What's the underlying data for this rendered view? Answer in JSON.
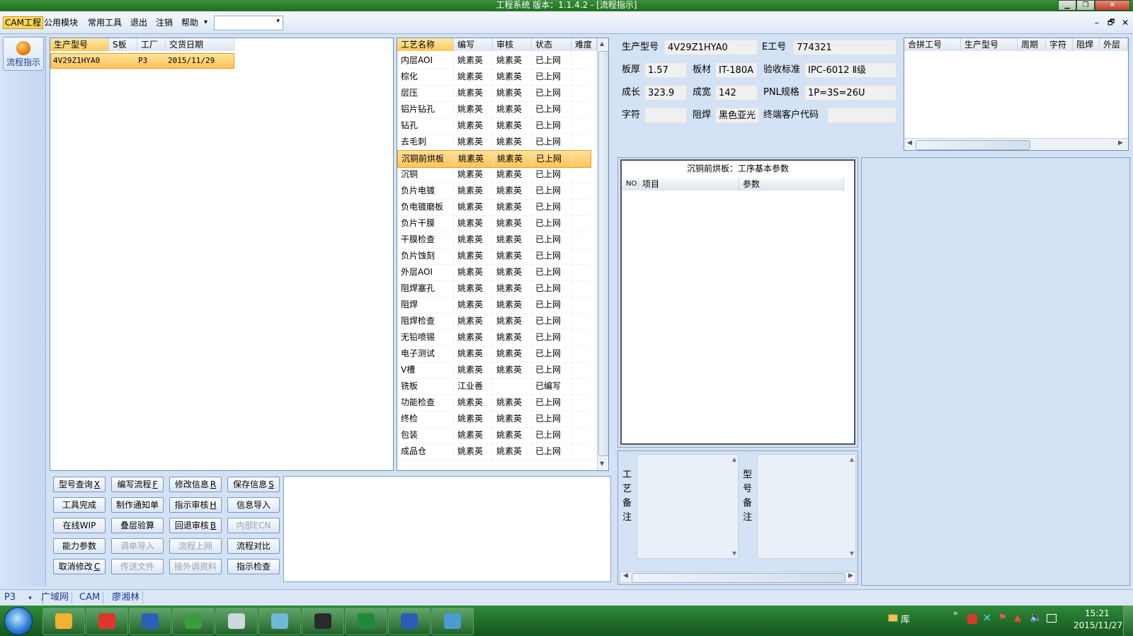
{
  "window": {
    "title": "工程系统   版本：1.1.4.2 - [流程指示]",
    "min_icon": "minimize-icon",
    "max_icon": "maximize-icon",
    "close_icon": "close-icon",
    "min_glyph": "▁",
    "max_glyph": "❐",
    "close_glyph": "✕"
  },
  "menubar": {
    "items": [
      "CAM工程",
      "公用模块",
      "常用工具",
      "退出",
      "注销",
      "帮助"
    ],
    "help_arrow": "▾",
    "combo_value": "",
    "combo_arrow": "▾",
    "mdi_min": "–",
    "mdi_restore": "🗗",
    "mdi_close": "✕"
  },
  "nav": {
    "button_label": "流程指示"
  },
  "order_table": {
    "columns": [
      "生产型号",
      "S板",
      "工厂",
      "交货日期"
    ],
    "rows": [
      {
        "model": "4V29Z1HYA0",
        "s": "",
        "factory": "P3",
        "date": "2015/11/29"
      }
    ]
  },
  "process_table": {
    "columns": [
      "工艺名称",
      "编写",
      "审核",
      "状态",
      "难度"
    ],
    "selected_index": 6,
    "rows": [
      [
        "内层AOI",
        "姚素英",
        "姚素英",
        "已上网"
      ],
      [
        "棕化",
        "姚素英",
        "姚素英",
        "已上网"
      ],
      [
        "层压",
        "姚素英",
        "姚素英",
        "已上网"
      ],
      [
        "铝片钻孔",
        "姚素英",
        "姚素英",
        "已上网"
      ],
      [
        "钻孔",
        "姚素英",
        "姚素英",
        "已上网"
      ],
      [
        "去毛刺",
        "姚素英",
        "姚素英",
        "已上网"
      ],
      [
        "沉铜前烘板",
        "姚素英",
        "姚素英",
        "已上网"
      ],
      [
        "沉铜",
        "姚素英",
        "姚素英",
        "已上网"
      ],
      [
        "负片电镀",
        "姚素英",
        "姚素英",
        "已上网"
      ],
      [
        "负电镀磨板",
        "姚素英",
        "姚素英",
        "已上网"
      ],
      [
        "负片干膜",
        "姚素英",
        "姚素英",
        "已上网"
      ],
      [
        "干膜检查",
        "姚素英",
        "姚素英",
        "已上网"
      ],
      [
        "负片蚀刻",
        "姚素英",
        "姚素英",
        "已上网"
      ],
      [
        "外层AOI",
        "姚素英",
        "姚素英",
        "已上网"
      ],
      [
        "阻焊塞孔",
        "姚素英",
        "姚素英",
        "已上网"
      ],
      [
        "阻焊",
        "姚素英",
        "姚素英",
        "已上网"
      ],
      [
        "阻焊检查",
        "姚素英",
        "姚素英",
        "已上网"
      ],
      [
        "无铅喷锡",
        "姚素英",
        "姚素英",
        "已上网"
      ],
      [
        "电子测试",
        "姚素英",
        "姚素英",
        "已上网"
      ],
      [
        "V槽",
        "姚素英",
        "姚素英",
        "已上网"
      ],
      [
        "铣板",
        "江业善",
        "",
        "已编写"
      ],
      [
        "功能检查",
        "姚素英",
        "姚素英",
        "已上网"
      ],
      [
        "终检",
        "姚素英",
        "姚素英",
        "已上网"
      ],
      [
        "包装",
        "姚素英",
        "姚素英",
        "已上网"
      ],
      [
        "成品仓",
        "姚素英",
        "姚素英",
        "已上网"
      ]
    ]
  },
  "info": {
    "model_label": "生产型号",
    "model_value": "4V29Z1HYA0",
    "e_label": "E工号",
    "e_value": "774321",
    "thickness_label": "板厚",
    "thickness_value": "1.57",
    "material_label": "板材",
    "material_value": "IT-180A",
    "standard_label": "验收标准",
    "standard_value": "IPC-6012 Ⅱ级",
    "len_label": "成长",
    "len_value": "323.9",
    "wid_label": "成宽",
    "wid_value": "142",
    "pnl_label": "PNL规格",
    "pnl_value": "1P=3S=26U",
    "char_label": "字符",
    "char_value": "",
    "mask_label": "阻焊",
    "mask_value": "黑色亚光",
    "cust_label": "终端客户代码",
    "cust_value": ""
  },
  "merge_table": {
    "columns": [
      "合拼工号",
      "生产型号",
      "周期",
      "字符",
      "阻焊",
      "外层"
    ]
  },
  "params": {
    "title": "沉铜前烘板：工序基本参数",
    "columns": [
      "NO",
      "项目",
      "参数"
    ]
  },
  "notes": {
    "process_label": "工\n艺\n备\n注",
    "model_label": "型\n号\n备\n注"
  },
  "buttons": [
    [
      "型号查询",
      "X"
    ],
    [
      "编写流程",
      "F"
    ],
    [
      "修改信息",
      "R"
    ],
    [
      "保存信息",
      "S"
    ],
    [
      "工具完成",
      ""
    ],
    [
      "制作通知单",
      ""
    ],
    [
      "指示审核",
      "H"
    ],
    [
      "信息导入",
      ""
    ],
    [
      "在线WIP",
      ""
    ],
    [
      "叠层验算",
      ""
    ],
    [
      "回退审核",
      "B"
    ],
    [
      "内部ECN",
      ""
    ],
    [
      "能力参数",
      ""
    ],
    [
      "调单导入",
      ""
    ],
    [
      "流程上网",
      ""
    ],
    [
      "流程对比",
      ""
    ],
    [
      "取消修改",
      "C"
    ],
    [
      "传送文件",
      ""
    ],
    [
      "接外调资料",
      ""
    ],
    [
      "指示检查",
      ""
    ]
  ],
  "disabled_buttons": [
    11,
    13,
    14,
    17,
    18
  ],
  "statusbar": {
    "factory": "P3",
    "network": "广域网",
    "dept": "CAM",
    "user": "廖湘林"
  },
  "taskbar": {
    "apps": [
      "shell-app-icon",
      "red-app-icon",
      "save-disk-icon",
      "green-f-app-icon",
      "calculator-icon",
      "eye-app-icon",
      "x-app-icon",
      "excel-icon",
      "word-icon",
      "gear-app-icon"
    ],
    "library_label": "库",
    "time": "15:21",
    "date": "2015/11/27"
  },
  "colors": {
    "accent": "#ffc85a",
    "taskbar": "#1f6f22",
    "panel_border": "#6f8fb8"
  }
}
